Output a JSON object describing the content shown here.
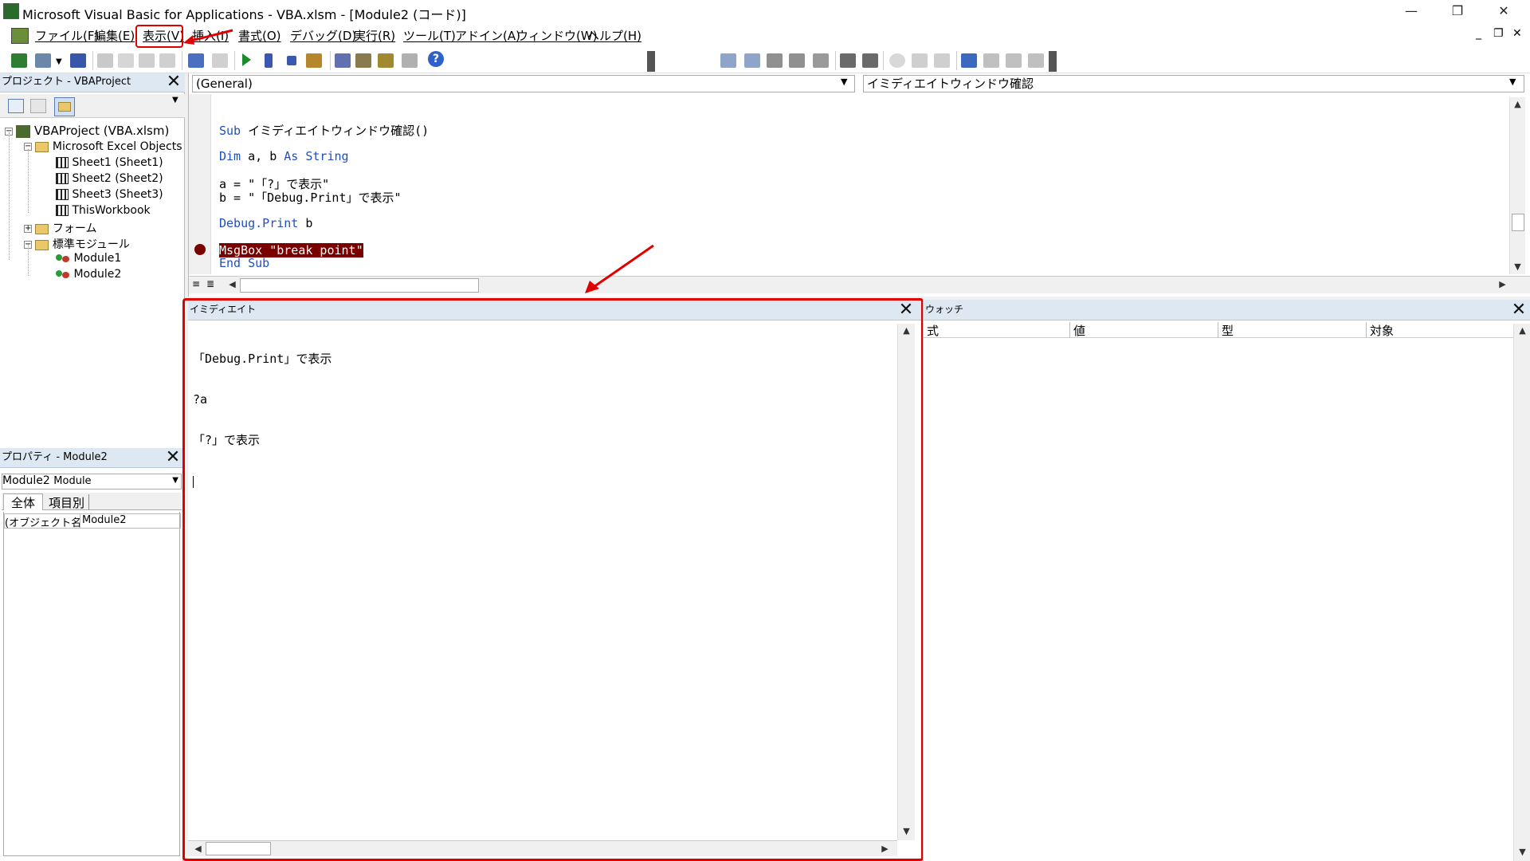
{
  "window": {
    "title": "Microsoft Visual Basic for Applications - VBA.xlsm - [Module2 (コード)]",
    "minimize": "—",
    "restore": "❐",
    "close": "✕"
  },
  "menu": {
    "items": [
      {
        "label": "ファイル",
        "key": "(F)"
      },
      {
        "label": "編集",
        "key": "(E)"
      },
      {
        "label": "表示",
        "key": "(V)"
      },
      {
        "label": "挿入",
        "key": "(I)"
      },
      {
        "label": "書式",
        "key": "(O)"
      },
      {
        "label": "デバッグ",
        "key": "(D)"
      },
      {
        "label": "実行",
        "key": "(R)"
      },
      {
        "label": "ツール",
        "key": "(T)"
      },
      {
        "label": "アドイン",
        "key": "(A)"
      },
      {
        "label": "ウィンドウ",
        "key": "(W)"
      },
      {
        "label": "ヘルプ",
        "key": "(H)"
      }
    ],
    "highlighted": "表示(V)",
    "mdi_min": "_",
    "mdi_restore": "❐",
    "mdi_close": "✕"
  },
  "project": {
    "title": "プロジェクト - VBAProject",
    "root": "VBAProject (VBA.xlsm)",
    "folder_excel": "Microsoft Excel Objects",
    "sheets": [
      "Sheet1 (Sheet1)",
      "Sheet2 (Sheet2)",
      "Sheet3 (Sheet3)",
      "ThisWorkbook"
    ],
    "folder_forms": "フォーム",
    "folder_modules": "標準モジュール",
    "modules": [
      "Module1",
      "Module2"
    ]
  },
  "properties": {
    "title": "プロパティ - Module2",
    "object_name": "Module2",
    "object_type": "Module",
    "tab_all": "全体",
    "tab_category": "項目別",
    "prop_name": "(オブジェクト名)",
    "prop_value": "Module2"
  },
  "code": {
    "object_combo": "(General)",
    "proc_combo": "イミディエイトウィンドウ確認",
    "line1_kw": "Sub",
    "line1_rest": " イミディエイトウィンドウ確認()",
    "line2_kw1": "Dim",
    "line2_mid": " a, b ",
    "line2_kw2": "As String",
    "line3": "a = \"「?」で表示\"",
    "line4": "b = \"「Debug.Print」で表示\"",
    "line5_kw": "Debug.Print",
    "line5_rest": " b",
    "line6": "MsgBox \"break point\"",
    "line7": "End Sub"
  },
  "immediate": {
    "title": "イミディエイト",
    "lines": [
      "「Debug.Print」で表示",
      "?a",
      "「?」で表示"
    ]
  },
  "watch": {
    "title": "ウォッチ",
    "columns": [
      "式",
      "値",
      "型",
      "対象"
    ]
  },
  "colors": {
    "highlight_red": "#e00000",
    "keyword_blue": "#1f4fc1",
    "breakpoint_bg": "#7a0000",
    "panel_title_bg": "#dde8f3"
  }
}
